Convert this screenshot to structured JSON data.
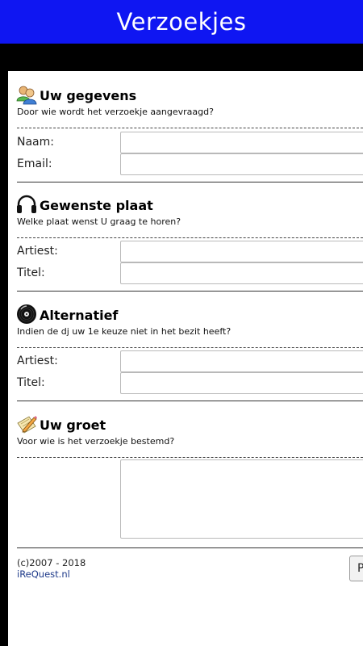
{
  "app": {
    "title": "Verzoekjes"
  },
  "sections": {
    "gegevens": {
      "icon": "users-icon",
      "title": "Uw gegevens",
      "subtitle": "Door wie wordt het verzoekje aangevraagd?",
      "fields": [
        {
          "label": "Naam:",
          "value": ""
        },
        {
          "label": "Email:",
          "value": ""
        }
      ]
    },
    "plaat": {
      "icon": "headphones-icon",
      "title": "Gewenste plaat",
      "subtitle": "Welke plaat wenst U graag te horen?",
      "fields": [
        {
          "label": "Artiest:",
          "value": ""
        },
        {
          "label": "Titel:",
          "value": ""
        }
      ]
    },
    "alternatief": {
      "icon": "vinyl-record-icon",
      "title": "Alternatief",
      "subtitle": "Indien de dj uw 1e keuze niet in het bezit heeft?",
      "fields": [
        {
          "label": "Artiest:",
          "value": ""
        },
        {
          "label": "Titel:",
          "value": ""
        }
      ]
    },
    "groet": {
      "icon": "note-pencil-icon",
      "title": "Uw groet",
      "subtitle": "Voor wie is het verzoekje bestemd?",
      "message": ""
    }
  },
  "footer": {
    "copyright": "(c)2007 - 2018",
    "link": "iReQuest.nl",
    "submit_label": "P"
  },
  "colors": {
    "appbar": "#0f16f2",
    "band": "#000000",
    "link": "#1e3a8a"
  }
}
